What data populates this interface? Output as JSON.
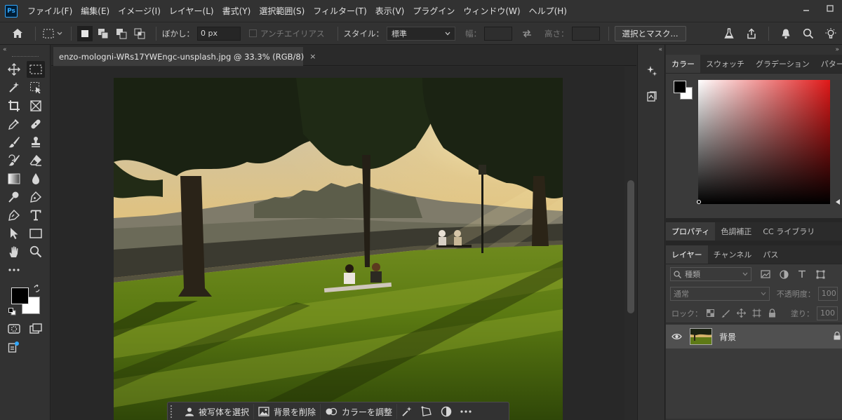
{
  "app": {
    "logo": "Ps"
  },
  "menu": [
    "ファイル(F)",
    "編集(E)",
    "イメージ(I)",
    "レイヤー(L)",
    "書式(Y)",
    "選択範囲(S)",
    "フィルター(T)",
    "表示(V)",
    "プラグイン",
    "ウィンドウ(W)",
    "ヘルプ(H)"
  ],
  "options": {
    "feather_label": "ぼかし：",
    "feather_value": "0 px",
    "antialias_label": "アンチエイリアス",
    "style_label": "スタイル：",
    "style_value": "標準",
    "width_label": "幅：",
    "height_label": "高さ：",
    "select_mask_button": "選択とマスク..."
  },
  "document": {
    "tab_title": "enzo-mologni-WRs17YWEngc-unsplash.jpg @ 33.3% (RGB/8)",
    "close_glyph": "×"
  },
  "taskbar": {
    "select_subject": "被写体を選択",
    "remove_background": "背景を削除",
    "adjust_color": "カラーを調整"
  },
  "panels": {
    "color_tabs": [
      "カラー",
      "スウォッチ",
      "グラデーション",
      "パターン"
    ],
    "properties_tabs": [
      "プロパティ",
      "色調補正",
      "CC ライブラリ"
    ],
    "layers_tabs": [
      "レイヤー",
      "チャンネル",
      "パス"
    ],
    "search_placeholder": "種類",
    "blend_mode": "通常",
    "opacity_label": "不透明度：",
    "opacity_value": "100",
    "lock_label": "ロック：",
    "fill_label": "塗り：",
    "fill_value": "100",
    "layer_name": "背景"
  },
  "colors": {
    "foreground": "#000000",
    "background": "#ffffff",
    "spectrum_hue": "#e01818"
  }
}
